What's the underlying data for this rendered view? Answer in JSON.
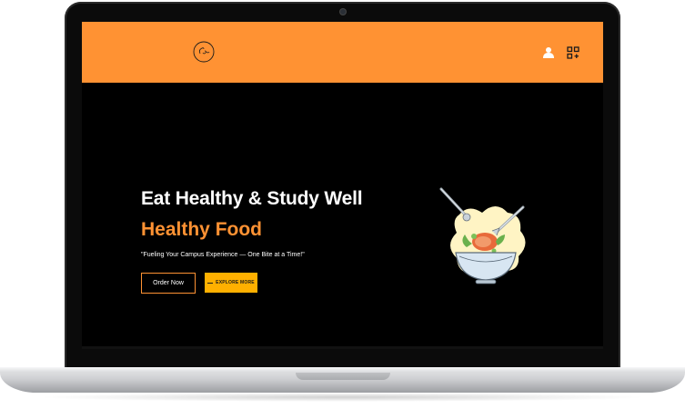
{
  "header": {
    "logo_alt": "Cozie",
    "icons": [
      "user-icon",
      "apps-icon"
    ]
  },
  "hero": {
    "title": "Eat Healthy & Study Well",
    "subtitle": "Healthy Food",
    "tagline": "\"Fueling Your Campus Experience — One Bite at a Time!\"",
    "order_button": "Order Now",
    "explore_button": "EXPLORE MORE"
  },
  "colors": {
    "accent": "#ff9233",
    "explore": "#ffb000",
    "background": "#000000"
  }
}
